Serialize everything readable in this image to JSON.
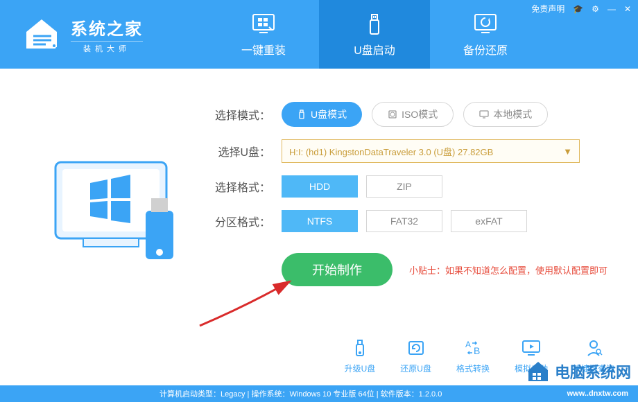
{
  "header": {
    "logo_title": "系统之家",
    "logo_sub": "装机大师",
    "free_disclaimer": "免责声明",
    "tabs": [
      {
        "label": "一键重装",
        "active": false
      },
      {
        "label": "U盘启动",
        "active": true
      },
      {
        "label": "备份还原",
        "active": false
      }
    ]
  },
  "form": {
    "mode_label": "选择模式：",
    "modes": [
      {
        "label": "U盘模式",
        "active": true
      },
      {
        "label": "ISO模式",
        "active": false
      },
      {
        "label": "本地模式",
        "active": false
      }
    ],
    "udisk_label": "选择U盘：",
    "udisk_value": "H:I: (hd1) KingstonDataTraveler 3.0 (U盘) 27.82GB",
    "format_label": "选择格式：",
    "formats": [
      {
        "label": "HDD",
        "active": true
      },
      {
        "label": "ZIP",
        "active": false
      }
    ],
    "partition_label": "分区格式：",
    "partitions": [
      {
        "label": "NTFS",
        "active": true
      },
      {
        "label": "FAT32",
        "active": false
      },
      {
        "label": "exFAT",
        "active": false
      }
    ],
    "start_button": "开始制作",
    "tip": "小贴士：如果不知道怎么配置，使用默认配置即可"
  },
  "bottom": [
    {
      "label": "升级U盘"
    },
    {
      "label": "还原U盘"
    },
    {
      "label": "格式转换"
    },
    {
      "label": "模拟启动"
    },
    {
      "label": "快捷键查询"
    }
  ],
  "status": "计算机启动类型：Legacy | 操作系统：Windows 10 专业版 64位 | 软件版本：1.2.0.0",
  "watermark": {
    "text": "电脑系统网",
    "url": "www..dnxtw.com"
  }
}
